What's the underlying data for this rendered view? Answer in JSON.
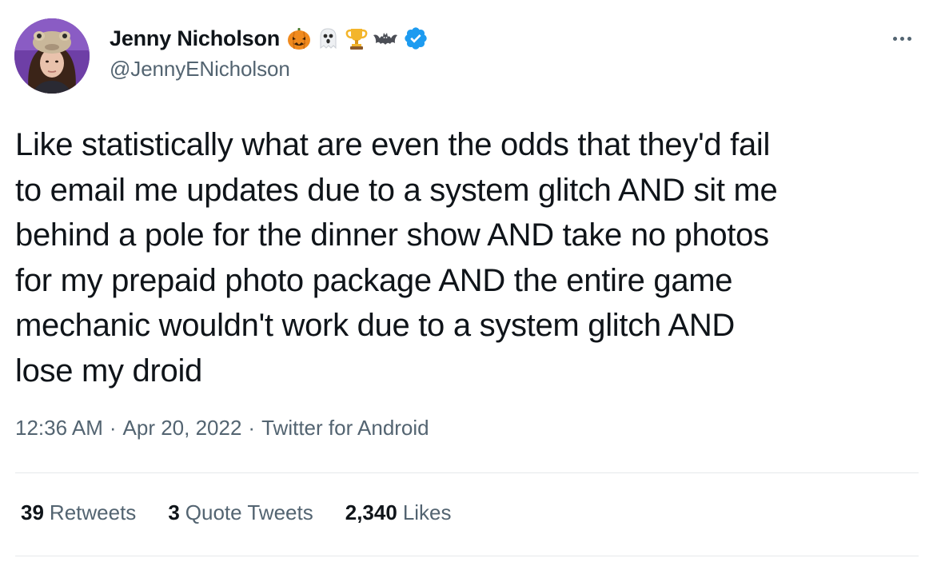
{
  "user": {
    "display_name": "Jenny Nicholson",
    "handle": "@JennyENicholson",
    "name_emojis": [
      "pumpkin-icon",
      "ghost-icon",
      "trophy-icon",
      "bat-icon"
    ],
    "verified": true
  },
  "tweet": {
    "text": "Like statistically what are even the odds that they'd fail\nto email me updates due to a system glitch AND sit me\nbehind a pole for the dinner show AND take no photos\nfor my prepaid photo package AND the entire game\nmechanic wouldn't work due to a system glitch AND\nlose my droid",
    "time": "12:36 AM",
    "separator": "·",
    "date": "Apr 20, 2022",
    "source": "Twitter for Android"
  },
  "stats": {
    "retweets_count": "39",
    "retweets_label": "Retweets",
    "quotes_count": "3",
    "quotes_label": "Quote Tweets",
    "likes_count": "2,340",
    "likes_label": "Likes"
  },
  "colors": {
    "text_primary": "#0f1419",
    "text_secondary": "#536471",
    "verified_blue": "#1d9bf0",
    "divider": "#e6e9eb"
  }
}
